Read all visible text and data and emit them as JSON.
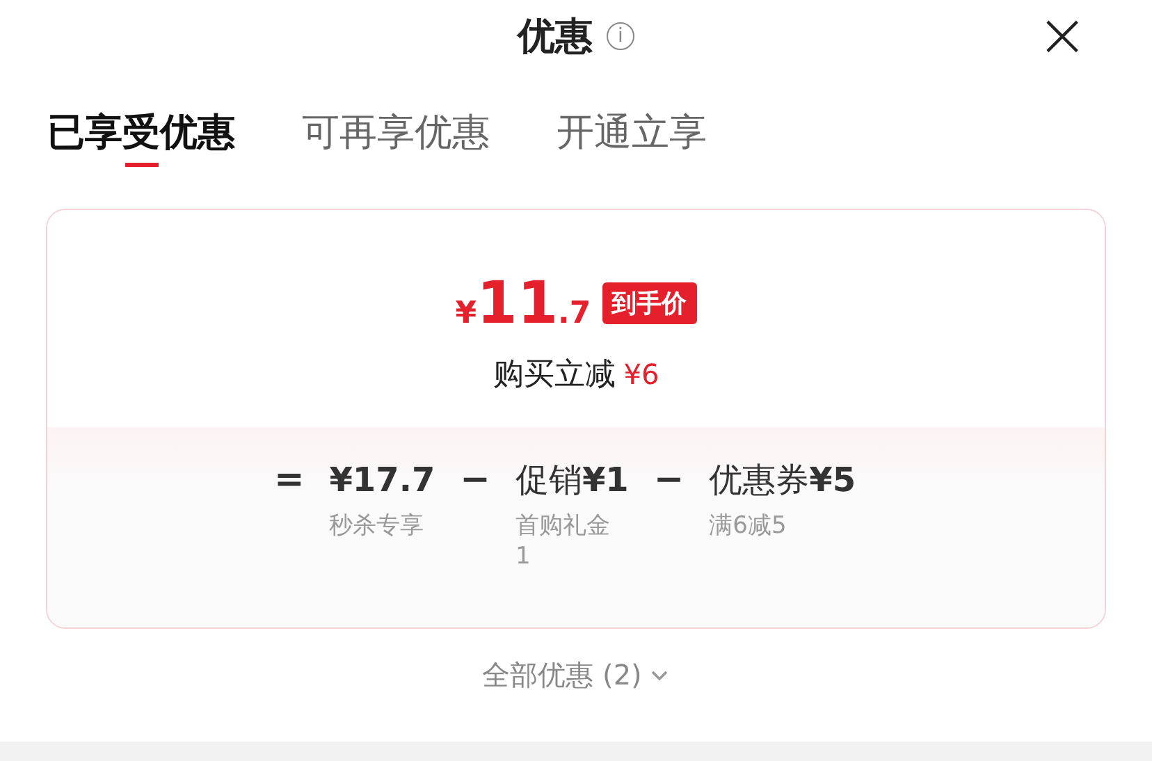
{
  "header": {
    "title": "优惠",
    "info_icon": "i",
    "close": "×"
  },
  "tabs": [
    {
      "label": "已享受优惠",
      "selected": true
    },
    {
      "label": "可再享优惠",
      "selected": false
    },
    {
      "label": "开通立享",
      "selected": false
    }
  ],
  "card": {
    "price": {
      "currency": "¥",
      "integer": "11",
      "decimal": ".7",
      "badge": "到手价"
    },
    "saving": {
      "label": "购买立减",
      "amount": "¥6"
    },
    "breakdown": [
      {
        "operator": "=",
        "amount": "¥17.7",
        "note": "秒杀专享"
      },
      {
        "operator": "−",
        "amount": "促销**¥1**",
        "note": "首购礼金1"
      },
      {
        "operator": "−",
        "amount": "优惠券**¥5**",
        "note": "满6减5"
      }
    ]
  },
  "footer": {
    "label": "全部优惠 (2)",
    "expanded": false
  }
}
